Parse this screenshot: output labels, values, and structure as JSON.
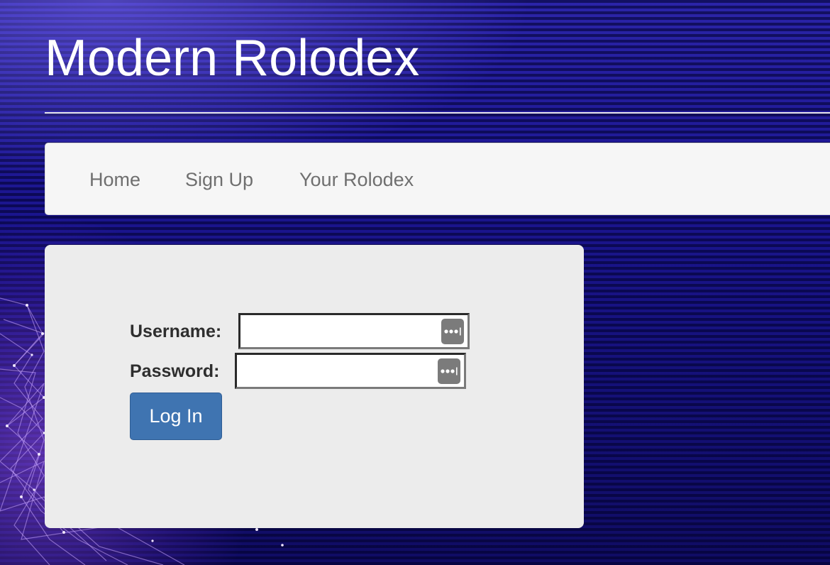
{
  "site": {
    "title": "Modern Rolodex"
  },
  "nav": {
    "items": [
      {
        "label": "Home"
      },
      {
        "label": "Sign Up"
      },
      {
        "label": "Your Rolodex"
      }
    ]
  },
  "login_form": {
    "username_label": "Username:",
    "username_value": "",
    "password_label": "Password:",
    "password_value": "",
    "submit_label": "Log In"
  },
  "icons": {
    "field_autofill": "password-manager-key-icon"
  },
  "colors": {
    "background": "#14107a",
    "navbar": "#f6f6f6",
    "panel": "#ececec",
    "button": "#3f74b1",
    "nav_text": "#6f6f6f"
  }
}
